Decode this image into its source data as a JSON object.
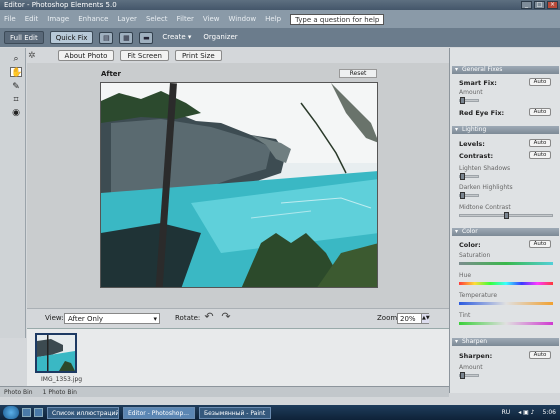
{
  "window": {
    "title": "Editor - Photoshop Elements 5.0"
  },
  "menu": {
    "items": [
      "File",
      "Edit",
      "Image",
      "Enhance",
      "Layer",
      "Select",
      "Filter",
      "View",
      "Window",
      "Help"
    ],
    "help_placeholder": "Type a question for help"
  },
  "modes": {
    "full_edit": "Full Edit",
    "quick_fix": "Quick Fix",
    "create": "Create",
    "organizer": "Organizer"
  },
  "quickfix_toolbar": {
    "about_photo": "About Photo",
    "fit_screen": "Fit Screen",
    "print_size": "Print Size"
  },
  "canvas": {
    "view_label": "After",
    "reset_label": "Reset"
  },
  "view_bar": {
    "view_label": "View:",
    "view_value": "After Only",
    "rotate_label": "Rotate:",
    "zoom_label": "Zoom:",
    "zoom_value": "20%"
  },
  "bin": {
    "thumb_label": "IMG_1353.jpg"
  },
  "status": {
    "left": "Photo Bin",
    "right": "1 Photo Bin"
  },
  "panel": {
    "general_fixes": {
      "title": "General Fixes",
      "smart_fix": "Smart Fix:",
      "amount": "Amount",
      "red_eye": "Red Eye Fix:",
      "auto": "Auto"
    },
    "lighting": {
      "title": "Lighting",
      "levels": "Levels:",
      "contrast": "Contrast:",
      "lighten_shadows": "Lighten Shadows",
      "darken_highlights": "Darken Highlights",
      "midtone_contrast": "Midtone Contrast",
      "auto": "Auto"
    },
    "color": {
      "title": "Color",
      "color": "Color:",
      "saturation": "Saturation",
      "hue": "Hue",
      "temperature": "Temperature",
      "tint": "Tint",
      "auto": "Auto"
    },
    "sharpen": {
      "title": "Sharpen",
      "sharpen": "Sharpen:",
      "amount": "Amount",
      "auto": "Auto"
    }
  },
  "taskbar": {
    "tasks": [
      "Список иллюстраций",
      "Editor - Photoshop...",
      "Безымянный - Paint"
    ],
    "lang": "RU",
    "clock": "5:06"
  },
  "colors": {
    "accent": "#1d3a63",
    "panel_header": "#7d8a96"
  }
}
